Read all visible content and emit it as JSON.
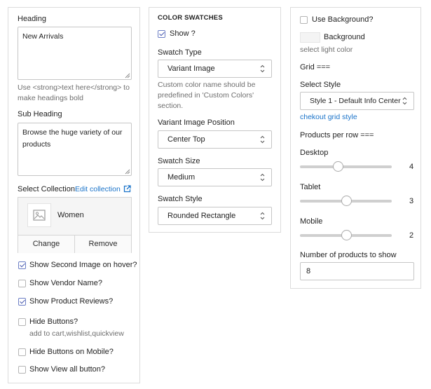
{
  "left": {
    "heading_label": "Heading",
    "heading_value": "New Arrivals",
    "heading_help": "Use <strong>text here</strong> to make headings bold",
    "subheading_label": "Sub Heading",
    "subheading_value": "Browse the huge variety of our products",
    "collection_label": "Select Collection",
    "edit_collection": "Edit collection",
    "collection_name": "Women",
    "change_label": "Change",
    "remove_label": "Remove",
    "checks": [
      {
        "label": "Show Second Image on hover?",
        "checked": true
      },
      {
        "label": "Show Vendor Name?",
        "checked": false
      },
      {
        "label": "Show Product Reviews?",
        "checked": true
      },
      {
        "label": "Hide Buttons?",
        "checked": false,
        "help": "add to cart,wishlist,quickview"
      },
      {
        "label": "Hide Buttons on Mobile?",
        "checked": false
      },
      {
        "label": "Show View all button?",
        "checked": false
      }
    ]
  },
  "middle": {
    "section_title": "COLOR SWATCHES",
    "show_label": "Show ?",
    "show_checked": true,
    "swatch_type_label": "Swatch Type",
    "swatch_type_value": "Variant Image",
    "swatch_type_help": "Custom color name should be predefined in 'Custom Colors' section.",
    "variant_position_label": "Variant Image Position",
    "variant_position_value": "Center Top",
    "swatch_size_label": "Swatch Size",
    "swatch_size_value": "Medium",
    "swatch_style_label": "Swatch Style",
    "swatch_style_value": "Rounded Rectangle"
  },
  "right": {
    "use_background_label": "Use Background?",
    "use_background_checked": false,
    "background_label": "Background",
    "background_help": "select light color",
    "grid_label": "Grid ===",
    "select_style_label": "Select Style",
    "select_style_value": "Style 1 - Default Info Center",
    "checkout_link": "chekout grid style",
    "products_per_row_label": "Products per row ===",
    "sliders": [
      {
        "label": "Desktop",
        "value": "4",
        "fraction": 0.41
      },
      {
        "label": "Tablet",
        "value": "3",
        "fraction": 0.5
      },
      {
        "label": "Mobile",
        "value": "2",
        "fraction": 0.5
      }
    ],
    "products_to_show_label": "Number of products to show",
    "products_to_show_value": "8"
  }
}
